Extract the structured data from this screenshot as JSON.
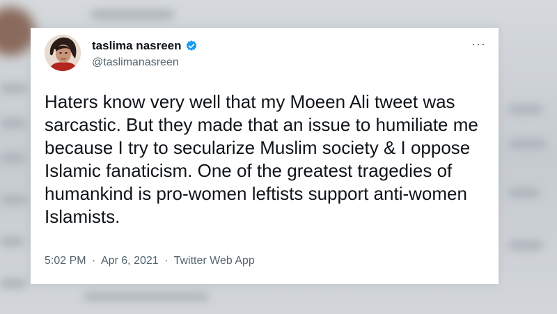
{
  "tweet": {
    "author_name": "taslima nasreen",
    "author_handle": "@taslimanasreen",
    "verified_icon": "verified-badge-icon",
    "more_icon": "more-options-icon",
    "more_label": "···",
    "text": "Haters know very well that my Moeen Ali tweet was\nsarcastic. But they made that an issue to humiliate me\nbecause I try to secularize Muslim society & I oppose\nIslamic fanaticism. One of the greatest tragedies of\nhumankind is pro-women leftists support anti-women\nIslamists.",
    "time": "5:02 PM",
    "date": "Apr 6, 2021",
    "separator": "·",
    "source_app": "Twitter Web App"
  },
  "colors": {
    "text_primary": "#0f1419",
    "text_secondary": "#536471",
    "verified_blue": "#1d9bf0",
    "card_background": "#ffffff"
  }
}
